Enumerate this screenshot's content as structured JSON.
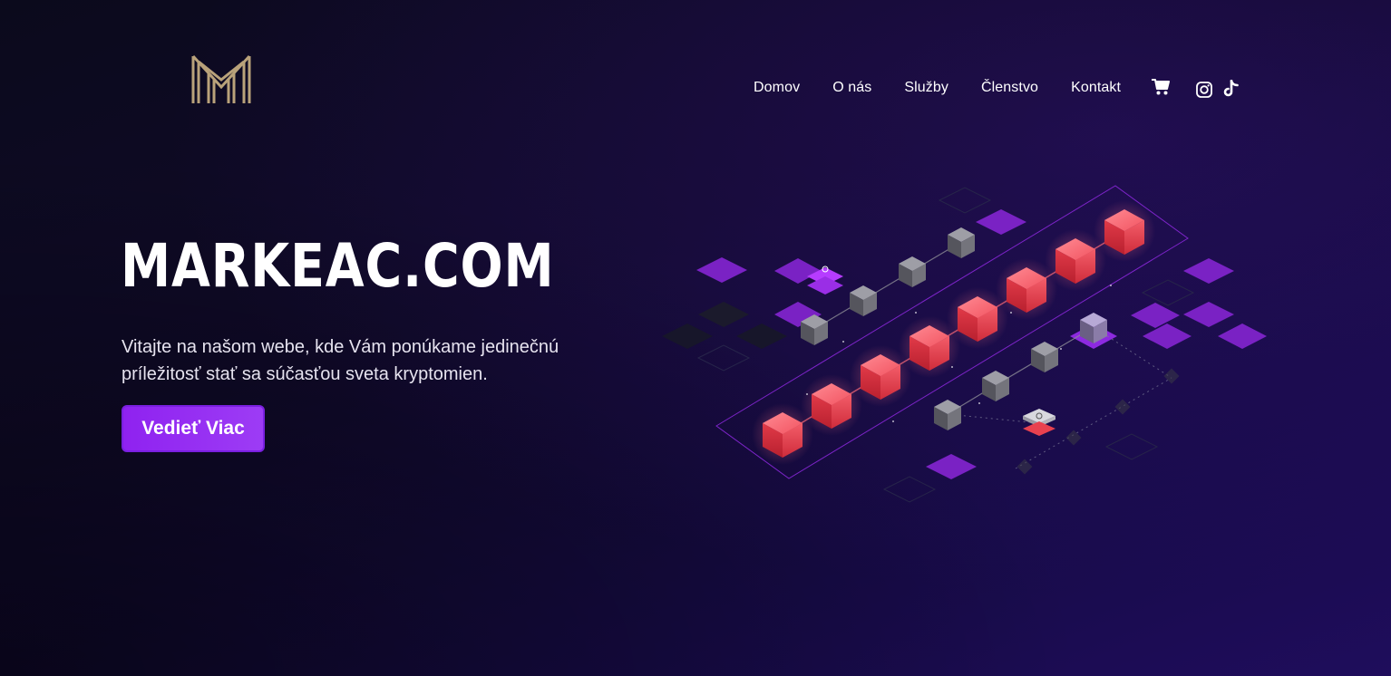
{
  "brand": {
    "logo_icon": "markeac-m-logo-icon",
    "gold": "#b9a27a"
  },
  "nav": {
    "items": [
      {
        "label": "Domov"
      },
      {
        "label": "O nás"
      },
      {
        "label": "Služby"
      },
      {
        "label": "Členstvo"
      },
      {
        "label": "Kontakt"
      }
    ],
    "icons": [
      "cart-icon",
      "instagram-icon",
      "tiktok-icon"
    ]
  },
  "hero": {
    "title": "MARKEAC.COM",
    "text": "Vitajte na našom webe, kde Vám ponúkame jedinečnú príležitosť stať sa súčasťou sveta kryptomien.",
    "cta_label": "Vedieť Viac",
    "cta_color": "#8f22f0"
  },
  "illustration": {
    "icon": "blockchain-isometric-illustration",
    "accent_red": "#e8414f",
    "accent_purple": "#8a22d6",
    "accent_gray": "#6b6b72"
  }
}
